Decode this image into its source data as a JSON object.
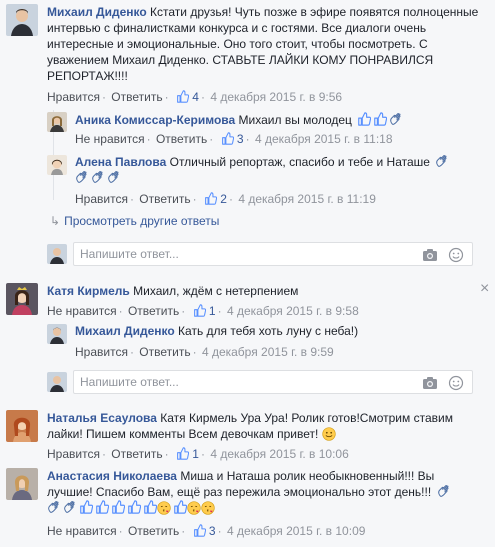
{
  "comments": [
    {
      "author": "Михаил Диденко",
      "text_lines": [
        "Кстати друзья! Чуть позже в эфире появятся полноценные",
        "интервью с финалистками конкурса и с гостями. Все диалоги очень",
        "интересные и эмоциональные. Оно того стоит, чтобы посмотреть. С",
        "уважением Михаил Диденко. СТАВЬТЕ ЛАЙКИ КОМУ ПОНРАВИЛСЯ",
        "РЕПОРТАЖ!!!!"
      ],
      "action1": "Нравится",
      "action2": "Ответить",
      "likes": "4",
      "timestamp": "4 декабря 2015 г. в 9:56"
    },
    {
      "author": "Аника Комиссар-Керимова",
      "text": "Михаил вы молодец",
      "action1": "Не нравится",
      "action2": "Ответить",
      "likes": "3",
      "timestamp": "4 декабря 2015 г. в 11:18"
    },
    {
      "author": "Алена Павлова",
      "text": "Отличный репортаж, спасибо и тебе и Наташе",
      "action1": "Нравится",
      "action2": "Ответить",
      "likes": "2",
      "timestamp": "4 декабря 2015 г. в 11:19"
    },
    {
      "author": "Катя Кирмель",
      "text": "Михаил, ждём с нетерпением",
      "action1": "Не нравится",
      "action2": "Ответить",
      "likes": "1",
      "timestamp": "4 декабря 2015 г. в 9:58"
    },
    {
      "author": "Михаил Диденко",
      "text": "Кать для тебя хоть луну с неба!)",
      "action1": "Нравится",
      "action2": "Ответить",
      "timestamp": "4 декабря 2015 г. в 9:59"
    },
    {
      "author": "Наталья Есаулова",
      "text_lines": [
        "Катя Кирмель Ура Ура! Ролик готов!Смотрим ставим",
        "лайки! Пишем комменты Всем девочкам привет!"
      ],
      "action1": "Нравится",
      "action2": "Ответить",
      "likes": "1",
      "timestamp": "4 декабря 2015 г. в 10:06"
    },
    {
      "author": "Анастасия Николаева",
      "text_lines": [
        "Миша и Наташа ролик необыкновенный!!! Вы",
        "лучшие! Спасибо Вам, ещё раз пережила эмоционально этот день!!!"
      ],
      "action1": "Не нравится",
      "action2": "Ответить",
      "likes": "3",
      "timestamp": "4 декабря 2015 г. в 10:09"
    }
  ],
  "view_more_replies": "Просмотреть другие ответы",
  "reply_placeholder": "Напишите ответ...",
  "close_symbol": "×",
  "colors": {
    "link": "#365899",
    "meta": "#90949c",
    "bg": "#f6f7f9",
    "like": "#5890ff"
  },
  "icons": [
    "thumbs-up-icon",
    "camera-icon",
    "smiley-icon",
    "clapping-hands-icon",
    "kiss-icon",
    "reply-arrow-icon",
    "close-icon"
  ]
}
